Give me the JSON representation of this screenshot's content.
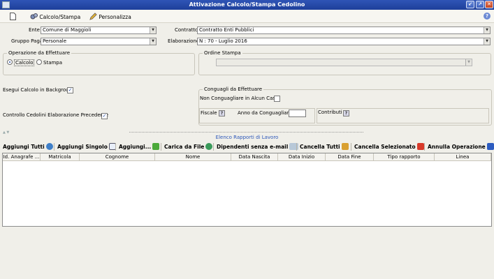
{
  "window": {
    "title": "Attivazione Calcolo/Stampa Cedolino",
    "icon": "app-icon"
  },
  "window_buttons": [
    "↙",
    "↗",
    "✕"
  ],
  "toolbar": {
    "new_icon": "new-document-icon",
    "calcolo_stampa_label": "Calcolo/Stampa",
    "personalizza_label": "Personalizza",
    "help_icon": "help-icon"
  },
  "form": {
    "ente": {
      "label": "Ente",
      "value": "Comune di Maggioli"
    },
    "contratto": {
      "label": "Contratto",
      "value": "Contratto Enti Pubblici"
    },
    "gruppo_paga": {
      "label": "Gruppo Paga",
      "value": "Personale"
    },
    "elaborazione": {
      "label": "Elaborazione",
      "value": "N : 70 - Luglio 2016"
    }
  },
  "operazione": {
    "legend": "Operazione da Effettuare",
    "calcolo": "Calcolo",
    "stampa": "Stampa",
    "selected": "Calcolo"
  },
  "ordine_stampa": {
    "legend": "Ordine Stampa",
    "value": ""
  },
  "options": {
    "background_label": "Esegui Calcolo in Backgroud",
    "background_checked": true,
    "controllo_label": "Controllo Cedolini Elaborazione Precedente",
    "controllo_checked": true
  },
  "conguagli": {
    "legend": "Conguagli da Effettuare",
    "non_conguagliare_label": "Non Conguagliare in Alcun Caso",
    "non_conguagliare_checked": false,
    "fiscale_label": "Fiscale",
    "anno_label": "Anno da Conguagliare",
    "anno_value": "",
    "contributi_label": "Contributi"
  },
  "rapporti": {
    "title": "Elenco Rapporti di Lavoro",
    "actions": [
      {
        "label": "Aggiungi Tutti",
        "icon": "globe-icon",
        "color": "#3f7fc8"
      },
      {
        "label": "Aggiungi Singolo",
        "icon": "page-icon",
        "color": "#e8eef8"
      },
      {
        "label": "Aggiungi...",
        "icon": "plus-icon",
        "color": "#4caa3a"
      },
      {
        "label": "Carica da File",
        "icon": "recycle-icon",
        "color": "#3a9a5a"
      },
      {
        "label": "Dipendenti senza e-mail",
        "icon": "email-icon",
        "color": "#b8c8d8"
      },
      {
        "label": "Cancella Tutti",
        "icon": "people-icon",
        "color": "#d9a030"
      },
      {
        "label": "Cancella Selezionato",
        "icon": "delete-icon",
        "color": "#d83a2a"
      },
      {
        "label": "Annulla Operazione",
        "icon": "exit-icon",
        "color": "#2d5cc0"
      }
    ],
    "columns": [
      "Id. Anagrafe ...",
      "Matricola",
      "Cognome",
      "Nome",
      "Data Nascita",
      "Data Inizio",
      "Data Fine",
      "Tipo rapporto",
      "Linea"
    ],
    "rows": []
  },
  "colors": {
    "titlebar": "#1e3f9a",
    "accent": "#2b56b8",
    "background": "#f0efe9"
  }
}
